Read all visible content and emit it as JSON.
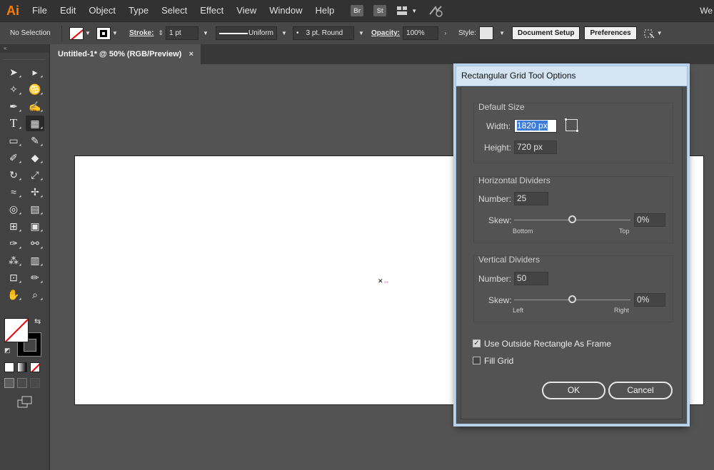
{
  "app": {
    "logo": "Ai",
    "right_text": "We"
  },
  "menu": [
    "File",
    "Edit",
    "Object",
    "Type",
    "Select",
    "Effect",
    "View",
    "Window",
    "Help"
  ],
  "menu_icons": [
    "Br",
    "St"
  ],
  "control": {
    "selection": "No Selection",
    "stroke_label": "Stroke:",
    "stroke_value": "1 pt",
    "profile": "Uniform",
    "brush": "3 pt. Round",
    "opacity_label": "Opacity:",
    "opacity_value": "100%",
    "style_label": "Style:",
    "document_setup": "Document Setup",
    "preferences": "Preferences"
  },
  "doc_tab": {
    "title": "Untitled-1* @ 50% (RGB/Preview)",
    "close": "×"
  },
  "dialog": {
    "title": "Rectangular Grid Tool Options",
    "default_size": {
      "title": "Default Size",
      "width_label": "Width:",
      "width_value": "1820 px",
      "height_label": "Height:",
      "height_value": "720 px"
    },
    "horizontal": {
      "title": "Horizontal Dividers",
      "number_label": "Number:",
      "number_value": "25",
      "skew_label": "Skew:",
      "skew_value": "0%",
      "left_end": "Bottom",
      "right_end": "Top",
      "skew_fraction": 0.5
    },
    "vertical": {
      "title": "Vertical Dividers",
      "number_label": "Number:",
      "number_value": "50",
      "skew_label": "Skew:",
      "skew_value": "0%",
      "left_end": "Left",
      "right_end": "Right",
      "skew_fraction": 0.5
    },
    "use_outside_rect": {
      "label": "Use Outside Rectangle As Frame",
      "checked": true
    },
    "fill_grid": {
      "label": "Fill Grid",
      "checked": false
    },
    "ok": "OK",
    "cancel": "Cancel"
  }
}
